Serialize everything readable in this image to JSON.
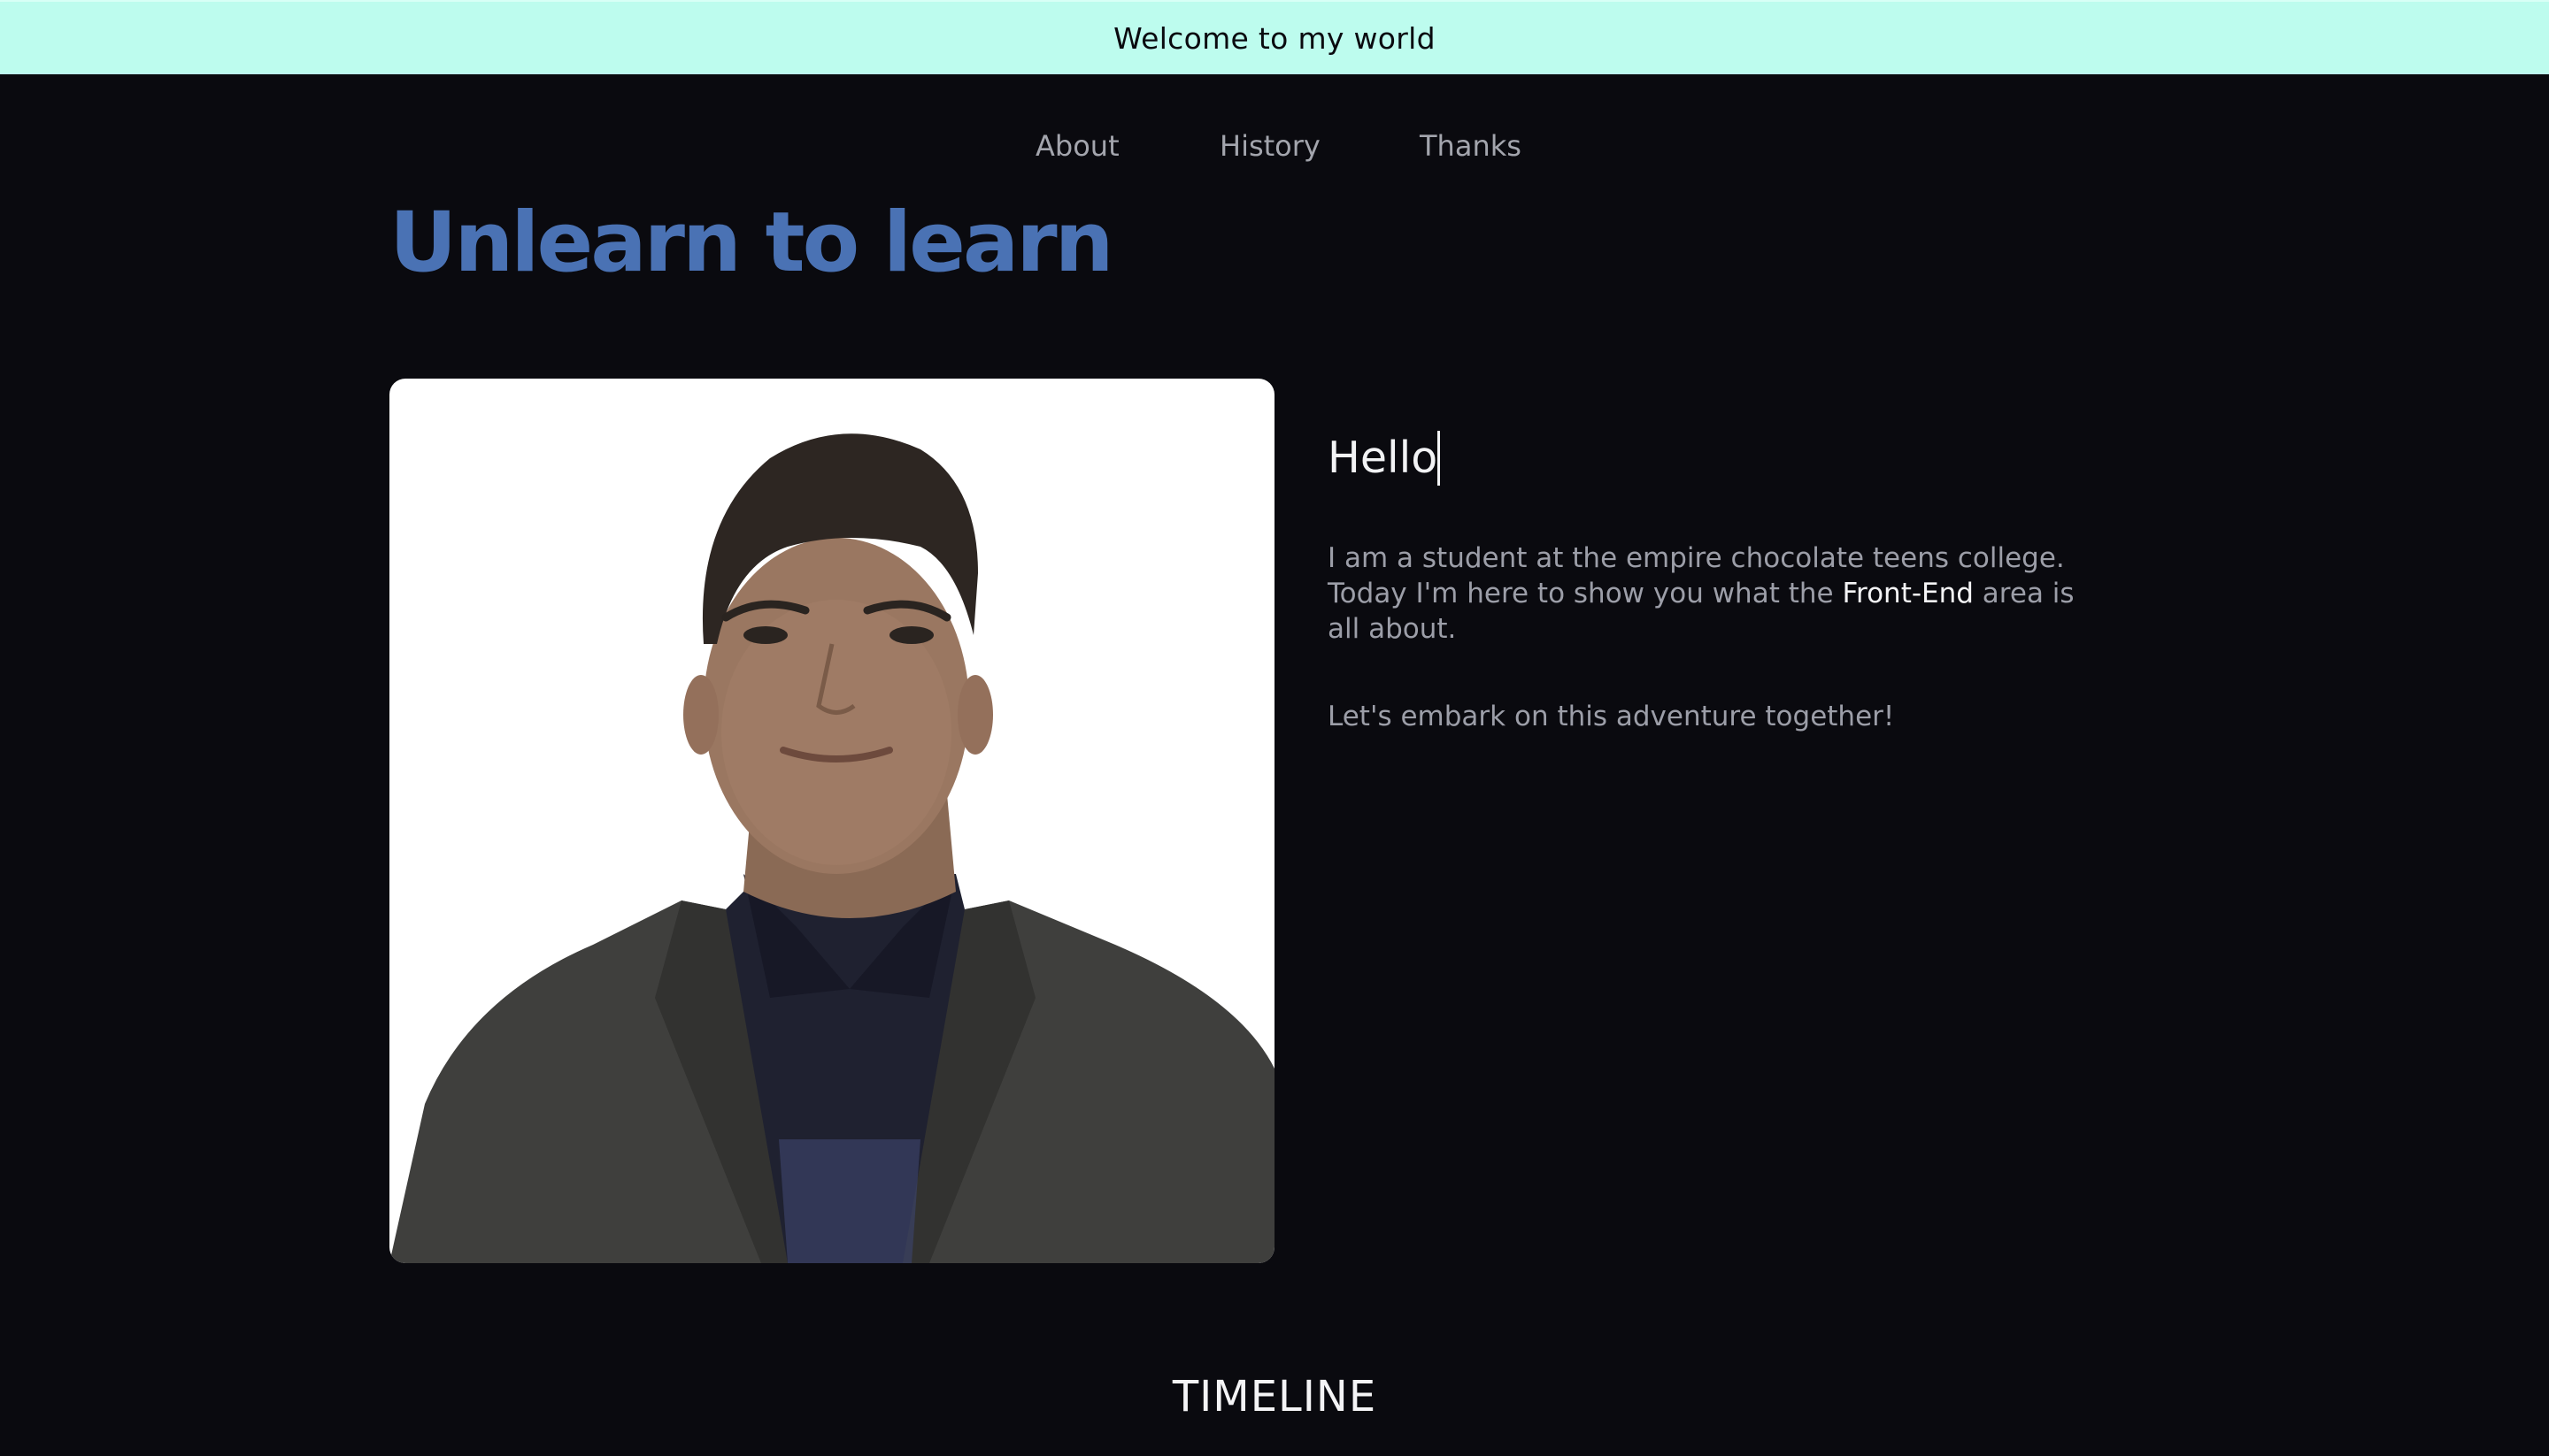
{
  "banner": {
    "text": "Welcome to my world"
  },
  "nav": {
    "items": [
      {
        "label": "About"
      },
      {
        "label": "History"
      },
      {
        "label": "Thanks"
      }
    ]
  },
  "hero": {
    "headline": "Unlearn to learn"
  },
  "intro": {
    "typed_greeting": "Hello",
    "paragraph1_before": "I am a student at the empire chocolate teens college. Today I'm here to show you what the ",
    "paragraph1_highlight": "Front-End",
    "paragraph1_after": " area is all about.",
    "paragraph2": "Let's embark on this adventure together!"
  },
  "section": {
    "title": "TIMELINE"
  },
  "colors": {
    "background": "#0a0a0f",
    "banner": "#bdfcee",
    "headline": "#4a72b4",
    "nav_text": "#a3a5ad",
    "body_text": "#9c9ea8",
    "highlight": "#f4f4f6"
  }
}
